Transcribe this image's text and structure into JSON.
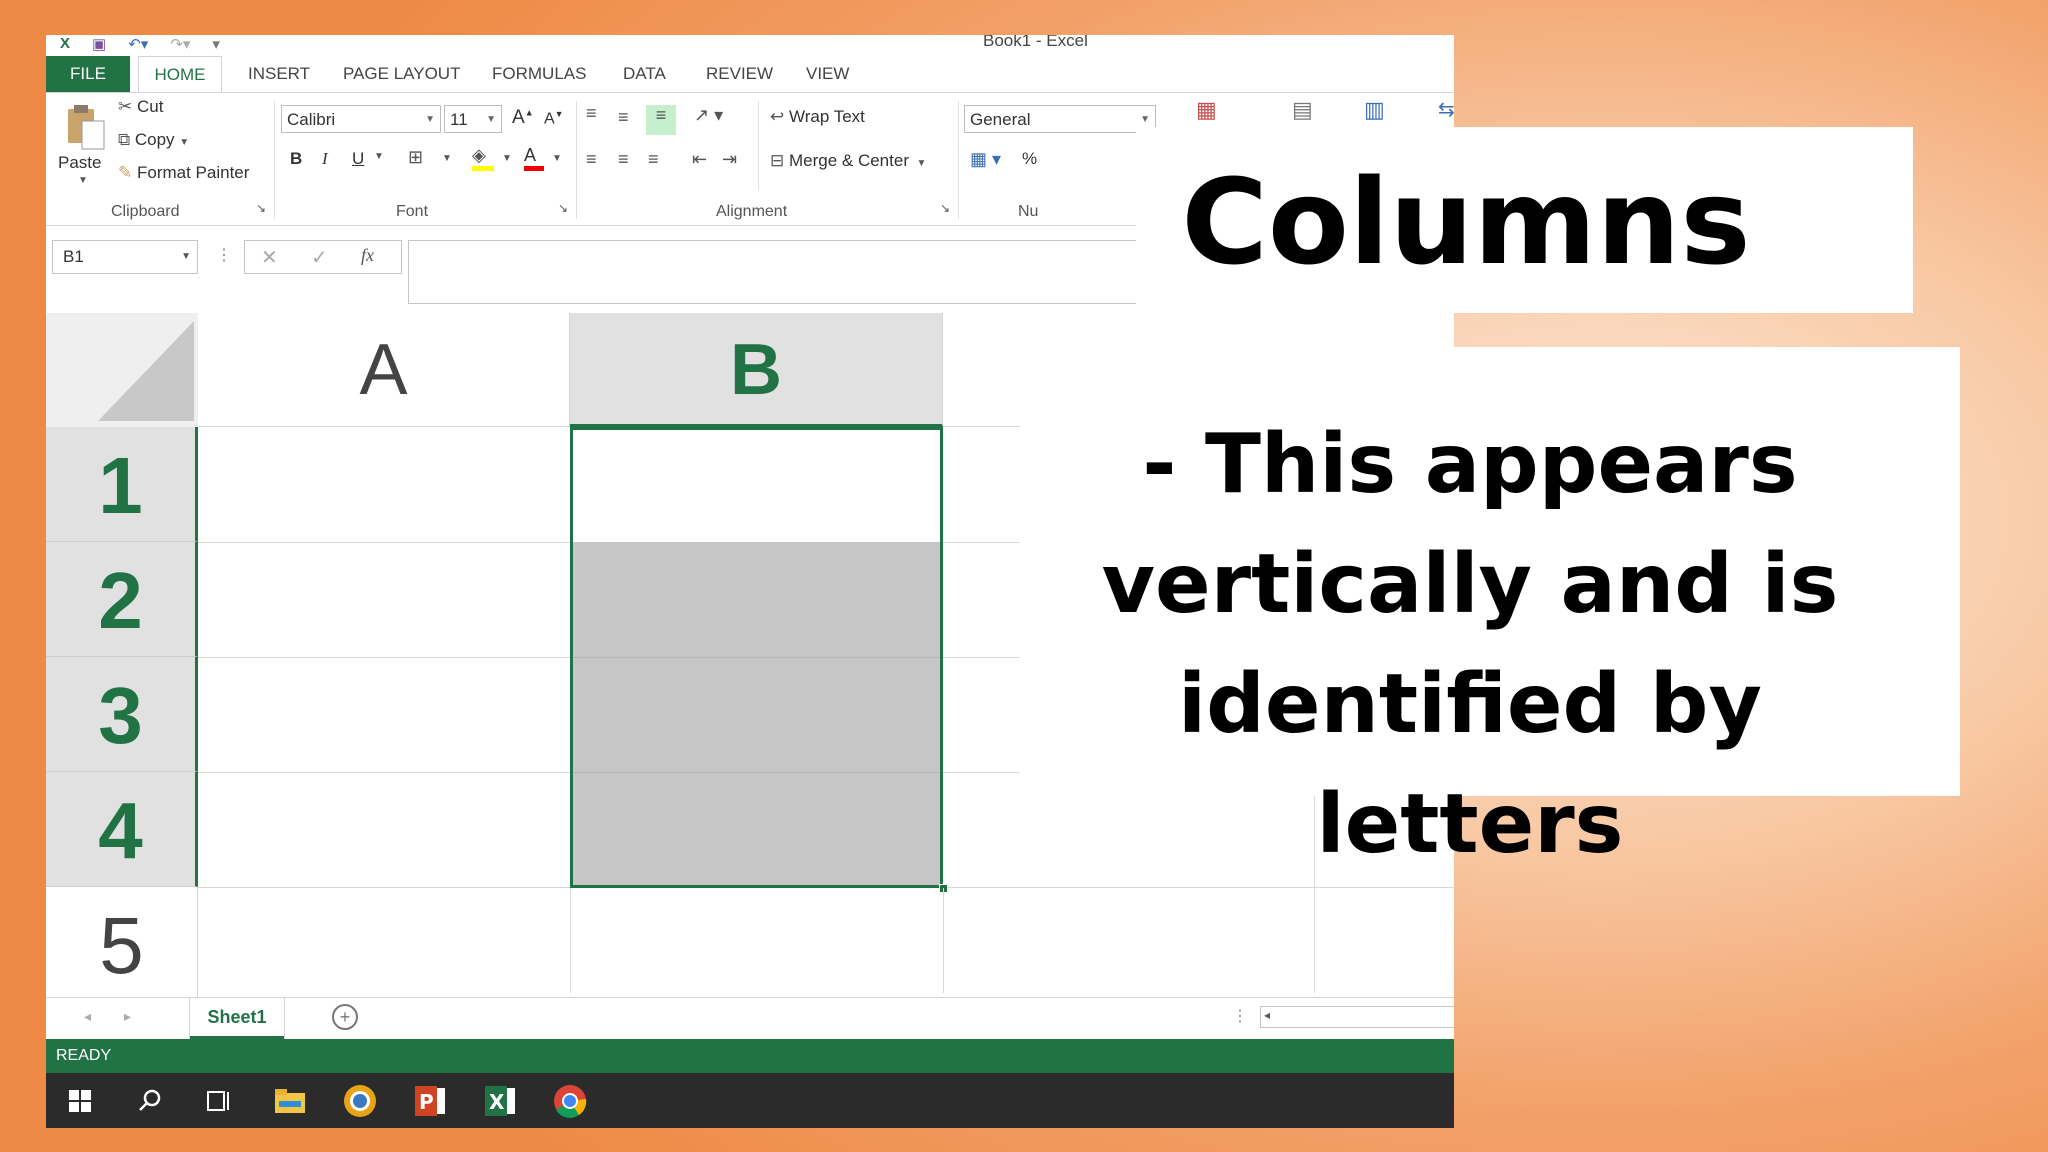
{
  "window": {
    "title": "Book1 - Excel"
  },
  "ribbon": {
    "tabs": [
      "FILE",
      "HOME",
      "INSERT",
      "PAGE LAYOUT",
      "FORMULAS",
      "DATA",
      "REVIEW",
      "VIEW"
    ],
    "clipboard": {
      "paste": "Paste",
      "cut": "Cut",
      "copy": "Copy",
      "format_painter": "Format Painter",
      "label": "Clipboard"
    },
    "font": {
      "name": "Calibri",
      "size": "11",
      "bold": "B",
      "italic": "I",
      "underline": "U",
      "grow": "A",
      "shrink": "A",
      "color": "A",
      "label": "Font"
    },
    "alignment": {
      "wrap_text": "Wrap Text",
      "merge_center": "Merge & Center",
      "label": "Alignment"
    },
    "number": {
      "format": "General",
      "label": "Nu",
      "percent": "%"
    }
  },
  "formula_bar": {
    "name_box": "B1",
    "fx": "fx",
    "value": ""
  },
  "sheet": {
    "columns": [
      "A",
      "B"
    ],
    "rows": [
      "1",
      "2",
      "3",
      "4",
      "5"
    ],
    "selected_column": "B",
    "tab": "Sheet1"
  },
  "status": {
    "text": "READY"
  },
  "overlay": {
    "title": "Columns",
    "body": [
      "- This appears",
      "vertically and is",
      "identified by letters"
    ]
  },
  "colors": {
    "excel_green": "#217346",
    "taskbar": "#2b2b2b",
    "background_orange": "#ee8a45"
  }
}
